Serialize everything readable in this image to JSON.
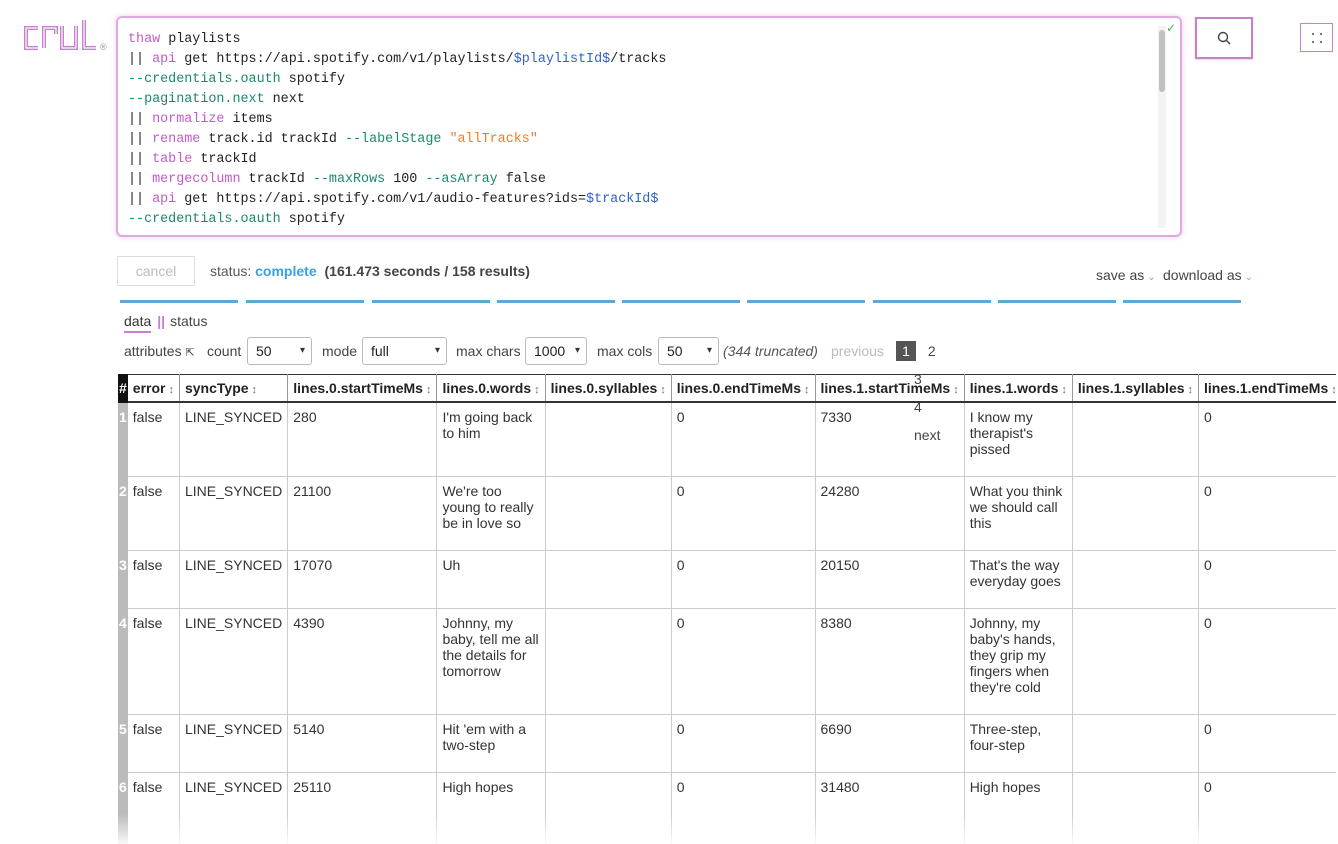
{
  "logo": {
    "text": "crul",
    "reg": "®"
  },
  "editor": {
    "lines": [
      [
        [
          "cmd",
          "thaw"
        ],
        [
          "txt",
          " playlists"
        ]
      ],
      [
        [
          "txt",
          "|| "
        ],
        [
          "cmd",
          "api"
        ],
        [
          "txt",
          " get https://api.spotify.com/v1/playlists/"
        ],
        [
          "var",
          "$playlistId$"
        ],
        [
          "txt",
          "/tracks"
        ]
      ],
      [
        [
          "flag",
          "--credentials.oauth"
        ],
        [
          "txt",
          " spotify"
        ]
      ],
      [
        [
          "flag",
          "--pagination.next"
        ],
        [
          "txt",
          " next"
        ]
      ],
      [
        [
          "txt",
          "|| "
        ],
        [
          "cmd",
          "normalize"
        ],
        [
          "txt",
          " items"
        ]
      ],
      [
        [
          "txt",
          "|| "
        ],
        [
          "cmd",
          "rename"
        ],
        [
          "txt",
          " track.id trackId "
        ],
        [
          "flag",
          "--labelStage"
        ],
        [
          "txt",
          " "
        ],
        [
          "str",
          "\"allTracks\""
        ]
      ],
      [
        [
          "txt",
          "|| "
        ],
        [
          "cmd",
          "table"
        ],
        [
          "txt",
          " trackId"
        ]
      ],
      [
        [
          "txt",
          "|| "
        ],
        [
          "cmd",
          "mergecolumn"
        ],
        [
          "txt",
          " trackId "
        ],
        [
          "flag",
          "--maxRows"
        ],
        [
          "txt",
          " 100 "
        ],
        [
          "flag",
          "--asArray"
        ],
        [
          "txt",
          " false"
        ]
      ],
      [
        [
          "txt",
          "|| "
        ],
        [
          "cmd",
          "api"
        ],
        [
          "txt",
          " get https://api.spotify.com/v1/audio-features?ids="
        ],
        [
          "var",
          "$trackId$"
        ]
      ],
      [
        [
          "flag",
          "--credentials.oauth"
        ],
        [
          "txt",
          " spotify"
        ]
      ]
    ],
    "check": "✓"
  },
  "toolbar": {
    "cancel": "cancel",
    "status_label": "status:",
    "status_value": "complete",
    "status_detail": "(161.473 seconds / 158 results)",
    "save_as": "save as",
    "download_as": "download as"
  },
  "tabs": {
    "data": "data",
    "sep": "||",
    "status": "status"
  },
  "controls": {
    "attributes": "attributes",
    "attributes_icon": "⇱",
    "count_label": "count",
    "count_value": "50",
    "mode_label": "mode",
    "mode_value": "full",
    "max_chars_label": "max chars",
    "max_chars_value": "1000",
    "max_cols_label": "max cols",
    "max_cols_value": "50",
    "truncated": "(344 truncated)",
    "previous": "previous",
    "pages": [
      "1",
      "2",
      "3",
      "4"
    ],
    "next": "next"
  },
  "table": {
    "columns": [
      "#",
      "error",
      "syncType",
      "lines.0.startTimeMs",
      "lines.0.words",
      "lines.0.syllables",
      "lines.0.endTimeMs",
      "lines.1.startTimeMs",
      "lines.1.words",
      "lines.1.syllables",
      "lines.1.endTimeMs"
    ],
    "rows": [
      [
        "1",
        "false",
        "LINE_SYNCED",
        "280",
        "I'm going back to him",
        "",
        "0",
        "7330",
        "I know my therapist's pissed",
        "",
        "0"
      ],
      [
        "2",
        "false",
        "LINE_SYNCED",
        "21100",
        "We're too young to really be in love so",
        "",
        "0",
        "24280",
        "What you think we should call this",
        "",
        "0"
      ],
      [
        "3",
        "false",
        "LINE_SYNCED",
        "17070",
        "Uh",
        "",
        "0",
        "20150",
        "That's the way everyday goes",
        "",
        "0"
      ],
      [
        "4",
        "false",
        "LINE_SYNCED",
        "4390",
        "Johnny, my baby, tell me all the details for tomorrow",
        "",
        "0",
        "8380",
        "Johnny, my baby's hands, they grip my fingers when they're cold",
        "",
        "0"
      ],
      [
        "5",
        "false",
        "LINE_SYNCED",
        "5140",
        "Hit 'em with a two-step",
        "",
        "0",
        "6690",
        "Three-step, four-step",
        "",
        "0"
      ],
      [
        "6",
        "false",
        "LINE_SYNCED",
        "25110",
        "High hopes",
        "",
        "0",
        "31480",
        "High hopes",
        "",
        "0"
      ]
    ]
  },
  "colors": {
    "accent": "#c77fce",
    "status": "#3aa0e0",
    "progress": "#5ba8dc"
  },
  "icons": {
    "search": "search-icon",
    "grid": "grid-icon"
  }
}
